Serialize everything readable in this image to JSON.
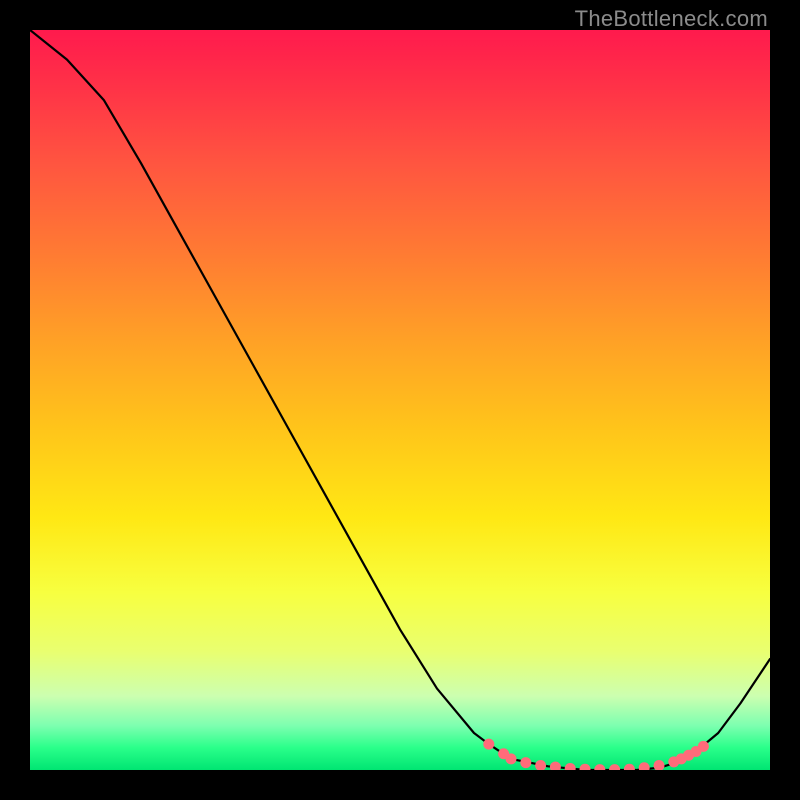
{
  "watermark": "TheBottleneck.com",
  "chart_data": {
    "type": "line",
    "title": "",
    "xlabel": "",
    "ylabel": "",
    "xlim": [
      0,
      100
    ],
    "ylim": [
      0,
      100
    ],
    "grid": false,
    "legend": false,
    "series": [
      {
        "name": "bottleneck-curve",
        "x": [
          0,
          5,
          10,
          15,
          20,
          25,
          30,
          35,
          40,
          45,
          50,
          55,
          60,
          62,
          65,
          70,
          75,
          78,
          80,
          82,
          85,
          88,
          90,
          93,
          96,
          100
        ],
        "values": [
          100,
          96,
          90.5,
          82,
          73,
          64,
          55,
          46,
          37,
          28,
          19,
          11,
          5,
          3.5,
          1.5,
          0.5,
          0,
          0,
          0,
          0,
          0.3,
          1.2,
          2.5,
          5,
          9,
          15
        ]
      }
    ],
    "markers": [
      {
        "x": 62,
        "y": 3.5
      },
      {
        "x": 64,
        "y": 2.2
      },
      {
        "x": 65,
        "y": 1.5
      },
      {
        "x": 67,
        "y": 1.0
      },
      {
        "x": 69,
        "y": 0.6
      },
      {
        "x": 71,
        "y": 0.4
      },
      {
        "x": 73,
        "y": 0.2
      },
      {
        "x": 75,
        "y": 0.1
      },
      {
        "x": 77,
        "y": 0.05
      },
      {
        "x": 79,
        "y": 0.05
      },
      {
        "x": 81,
        "y": 0.1
      },
      {
        "x": 83,
        "y": 0.3
      },
      {
        "x": 85,
        "y": 0.6
      },
      {
        "x": 87,
        "y": 1.1
      },
      {
        "x": 88,
        "y": 1.5
      },
      {
        "x": 89,
        "y": 2.0
      },
      {
        "x": 90,
        "y": 2.5
      },
      {
        "x": 91,
        "y": 3.2
      }
    ],
    "marker_color": "#ff6b7a",
    "line_color": "#000000"
  },
  "colors": {
    "frame_bg": "#000000",
    "watermark": "#8b8b8b"
  }
}
